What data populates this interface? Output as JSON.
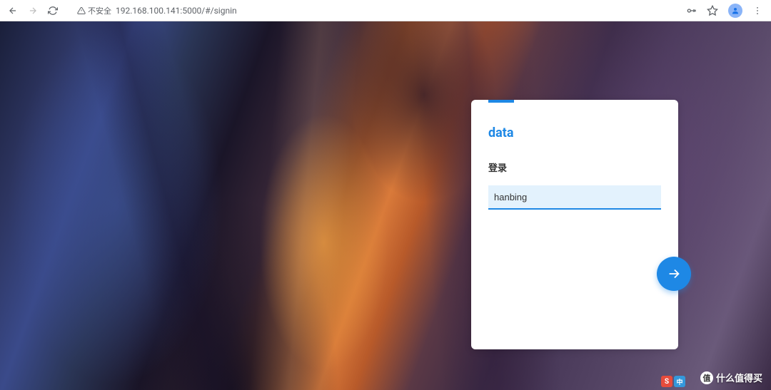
{
  "browser": {
    "url": "192.168.100.141:5000/#/signin",
    "security_label": "不安全"
  },
  "login": {
    "brand": "data",
    "heading": "登录",
    "username_value": "hanbing"
  },
  "watermark": {
    "logo_text": "值",
    "text": "什么值得买"
  },
  "ime": {
    "badge1": "S",
    "badge2": "中"
  }
}
